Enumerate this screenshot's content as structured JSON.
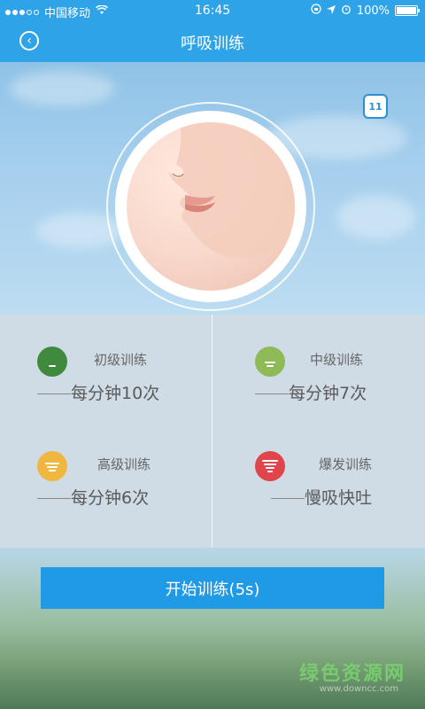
{
  "status_bar": {
    "carrier": "中国移动",
    "time": "16:45",
    "battery": "100%"
  },
  "nav": {
    "title": "呼吸训练"
  },
  "calendar": {
    "day": "11"
  },
  "training_levels": [
    {
      "label": "初级训练",
      "desc": "每分钟10次",
      "color": "#3f8a3c",
      "bars": 1
    },
    {
      "label": "中级训练",
      "desc": "每分钟7次",
      "color": "#8fba58",
      "bars": 2
    },
    {
      "label": "高级训练",
      "desc": "每分钟6次",
      "color": "#f0b740",
      "bars": 3
    },
    {
      "label": "爆发训练",
      "desc": "慢吸快吐",
      "color": "#e0454c",
      "bars": 4
    }
  ],
  "start_button": {
    "label": "开始训练(5s)"
  },
  "watermark": {
    "text": "绿色资源网",
    "sub": "www.downcc.com"
  }
}
